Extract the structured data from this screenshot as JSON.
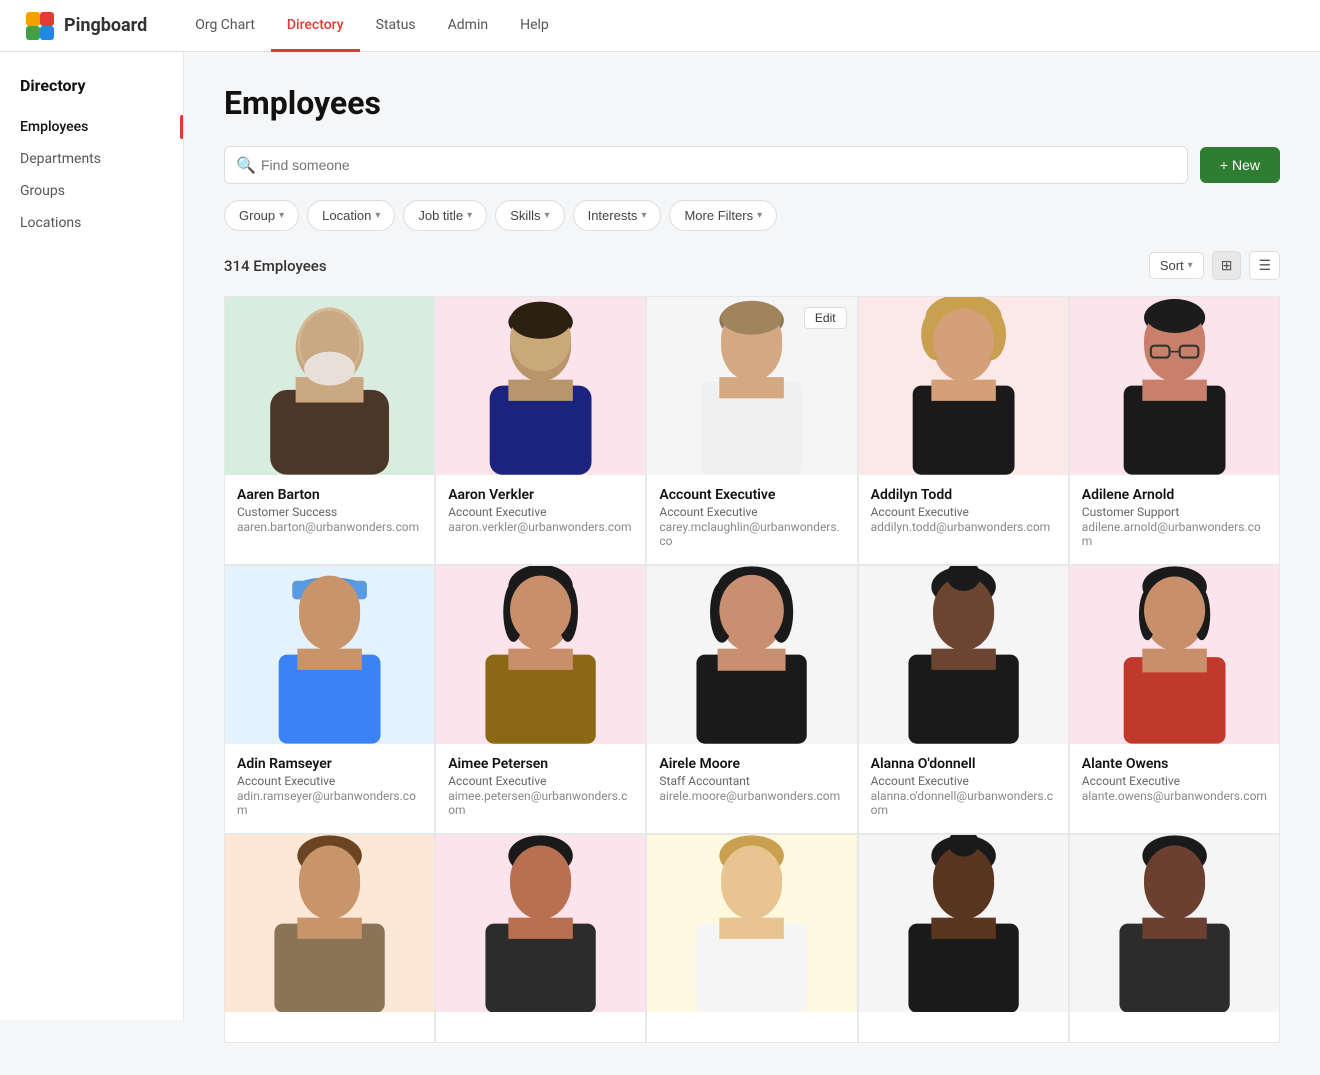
{
  "app": {
    "name": "Pingboard"
  },
  "topnav": {
    "links": [
      {
        "id": "org-chart",
        "label": "Org Chart",
        "active": false
      },
      {
        "id": "directory",
        "label": "Directory",
        "active": true
      },
      {
        "id": "status",
        "label": "Status",
        "active": false
      },
      {
        "id": "admin",
        "label": "Admin",
        "active": false
      },
      {
        "id": "help",
        "label": "Help",
        "active": false
      }
    ]
  },
  "sidebar": {
    "title": "Directory",
    "items": [
      {
        "id": "employees",
        "label": "Employees",
        "active": true
      },
      {
        "id": "departments",
        "label": "Departments",
        "active": false
      },
      {
        "id": "groups",
        "label": "Groups",
        "active": false
      },
      {
        "id": "locations",
        "label": "Locations",
        "active": false
      }
    ]
  },
  "main": {
    "page_title": "Employees",
    "search_placeholder": "Find someone",
    "new_button": "+ New",
    "filters": [
      {
        "id": "group",
        "label": "Group"
      },
      {
        "id": "location",
        "label": "Location"
      },
      {
        "id": "job-title",
        "label": "Job title"
      },
      {
        "id": "skills",
        "label": "Skills"
      },
      {
        "id": "interests",
        "label": "Interests"
      },
      {
        "id": "more-filters",
        "label": "More Filters"
      }
    ],
    "employee_count": "314 Employees",
    "sort_label": "Sort",
    "employees": [
      {
        "id": 1,
        "name": "Aaren Barton",
        "role": "Customer Success",
        "email": "aaren.barton@urbanwonders.com",
        "bg": "bg-green"
      },
      {
        "id": 2,
        "name": "Aaron Verkler",
        "role": "Account Executive",
        "email": "aaron.verkler@urbanwonders.com",
        "bg": "bg-pink"
      },
      {
        "id": 3,
        "name": "Account Executive",
        "role": "Account Executive",
        "email": "carey.mclaughlin@urbanwonders.co",
        "bg": "bg-gray",
        "show_edit": true
      },
      {
        "id": 4,
        "name": "Addilyn Todd",
        "role": "Account Executive",
        "email": "addilyn.todd@urbanwonders.com",
        "bg": "bg-peach"
      },
      {
        "id": 5,
        "name": "Adilene Arnold",
        "role": "Customer Support",
        "email": "adilene.arnold@urbanwonders.com",
        "bg": "bg-pink"
      },
      {
        "id": 6,
        "name": "Adin Ramseyer",
        "role": "Account Executive",
        "email": "adin.ramseyer@urbanwonders.com",
        "bg": "bg-blue"
      },
      {
        "id": 7,
        "name": "Aimee Petersen",
        "role": "Account Executive",
        "email": "aimee.petersen@urbanwonders.com",
        "bg": "bg-pink"
      },
      {
        "id": 8,
        "name": "Airele Moore",
        "role": "Staff Accountant",
        "email": "airele.moore@urbanwonders.com",
        "bg": "bg-gray"
      },
      {
        "id": 9,
        "name": "Alanna O'donnell",
        "role": "Account Executive",
        "email": "alanna.o'donnell@urbanwonders.com",
        "bg": "bg-gray"
      },
      {
        "id": 10,
        "name": "Alante Owens",
        "role": "Account Executive",
        "email": "alante.owens@urbanwonders.com",
        "bg": "bg-pink"
      }
    ],
    "bottom_row_count": 5,
    "edit_label": "Edit"
  },
  "colors": {
    "accent_red": "#e53935",
    "accent_green": "#2e7d32",
    "active_border": "#e53935"
  }
}
